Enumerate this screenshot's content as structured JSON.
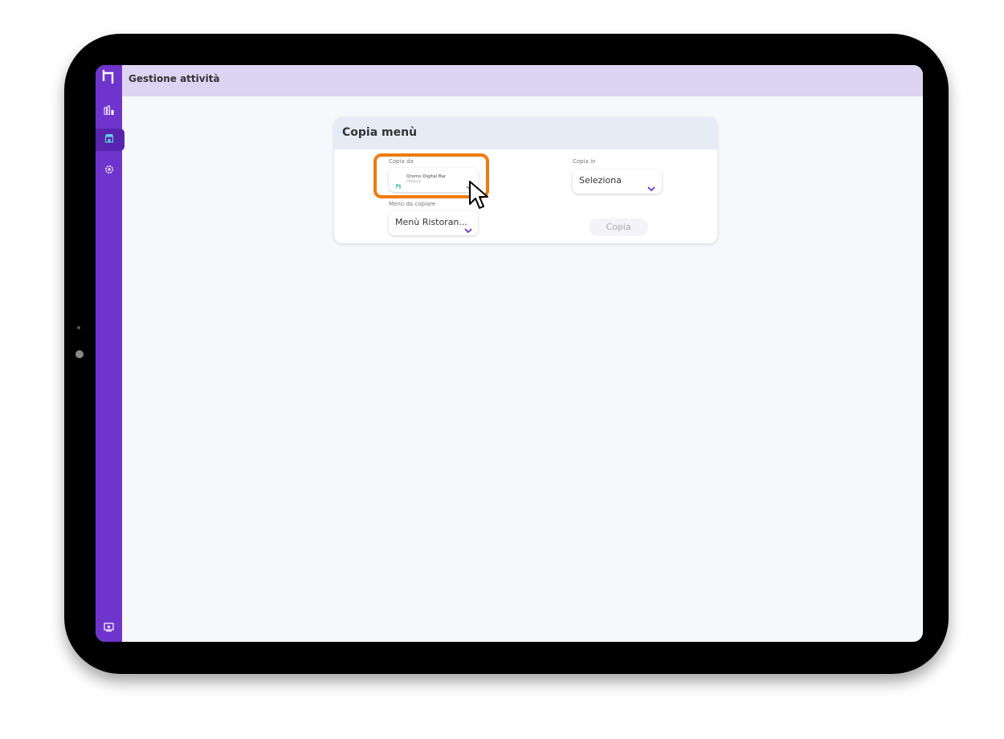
{
  "header": {
    "title": "Gestione attività"
  },
  "sidebar": {
    "items": [
      {
        "name": "stats",
        "icon": "bar-chart-icon"
      },
      {
        "name": "shop",
        "icon": "store-icon",
        "active": true
      },
      {
        "name": "settings",
        "icon": "gear-icon"
      }
    ],
    "bottom_icon": "monitor-star-icon"
  },
  "panel": {
    "title": "Copia menù",
    "copy_from": {
      "label": "Copia da",
      "value": "Qromo Digital Bar",
      "subvalue": "Pittwest"
    },
    "copy_to": {
      "label": "Copia in",
      "value": "Seleziona"
    },
    "menu": {
      "label": "Menù da copiare",
      "value": "Menù Ristoran..."
    },
    "copy_button": "Copia"
  },
  "colors": {
    "sidebar": "#6f34cc",
    "topbar": "#ddd4f3",
    "highlight": "#f07a10",
    "accent": "#6f34cc"
  }
}
